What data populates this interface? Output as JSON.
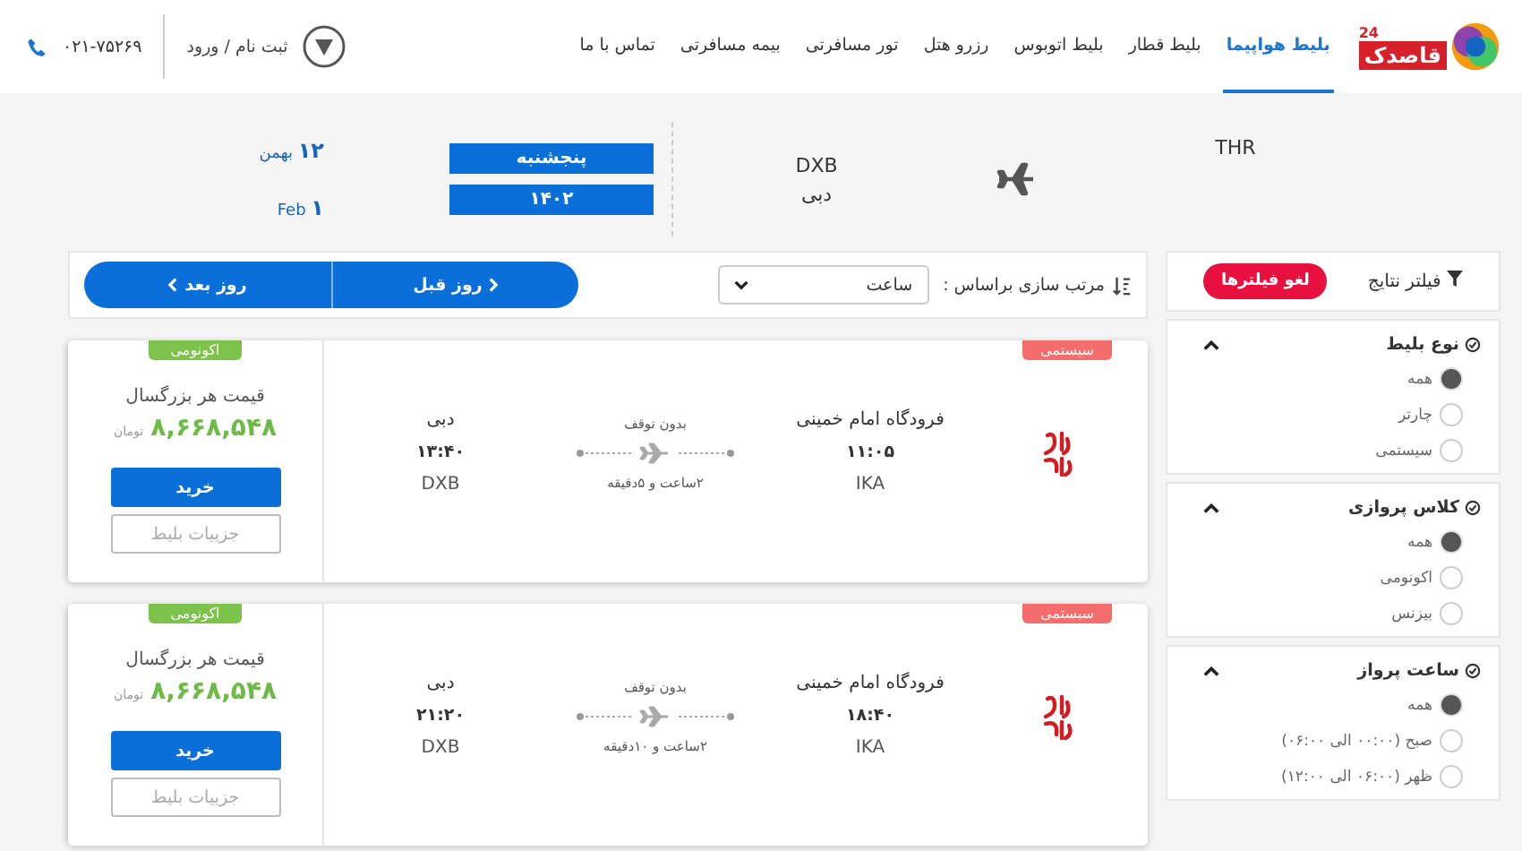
{
  "header": {
    "logo": {
      "text": "قاصدک",
      "badge": "24"
    },
    "nav": [
      {
        "label": "بلیط هواپیما",
        "selected": true
      },
      {
        "label": "بلیط قطار",
        "selected": false
      },
      {
        "label": "بلیط اتوبوس",
        "selected": false
      },
      {
        "label": "رزرو هتل",
        "selected": false
      },
      {
        "label": "تور مسافرتی",
        "selected": false
      },
      {
        "label": "بیمه مسافرتی",
        "selected": false
      },
      {
        "label": "تماس با ما",
        "selected": false
      }
    ],
    "login": "ثبت نام / ورود",
    "phone": "۰۲۱-۷۵۲۶۹"
  },
  "route": {
    "origin": "THR",
    "destination": {
      "code": "DXB",
      "city": "دبی"
    },
    "date": {
      "weekday": "پنجشنبه",
      "year": "۱۴۰۲",
      "persian": {
        "day": "۱۲",
        "month": "بهمن"
      },
      "gregorian": {
        "day": "۱",
        "month": "Feb"
      }
    }
  },
  "toolbar": {
    "sort_label": "مرتب سازی براساس :",
    "sort_value": "ساعت",
    "prev_day": "روز قبل",
    "next_day": "روز بعد"
  },
  "filters": {
    "title": "فیلتر نتایج",
    "clear": "لغو فیلترها",
    "groups": [
      {
        "title": "نوع بلیط",
        "expanded": true,
        "options": [
          {
            "label": "همه",
            "selected": true
          },
          {
            "label": "چارتر",
            "selected": false
          },
          {
            "label": "سیستمی",
            "selected": false
          }
        ]
      },
      {
        "title": "کلاس پروازی",
        "expanded": true,
        "options": [
          {
            "label": "همه",
            "selected": true
          },
          {
            "label": "اکونومی",
            "selected": false
          },
          {
            "label": "بیزنس",
            "selected": false
          }
        ]
      },
      {
        "title": "ساعت پرواز",
        "expanded": true,
        "options": [
          {
            "label": "همه",
            "selected": true
          },
          {
            "label": "صبح (۰۰:۰۰ الی ۰۶:۰۰)",
            "selected": false
          },
          {
            "label": "ظهر (۰۶:۰۰ الی ۱۲:۰۰)",
            "selected": false
          }
        ]
      }
    ]
  },
  "flights": [
    {
      "ticket_type": "سیستمی",
      "cabin": "اکونومی",
      "from": {
        "name": "فرودگاه امام خمینی",
        "time": "۱۱:۰۵",
        "code": "IKA"
      },
      "to": {
        "name": "دبی",
        "time": "۱۳:۴۰",
        "code": "DXB"
      },
      "stops": "بدون توقف",
      "duration": "۲ساعت و ۵دقیقه",
      "price_label": "قیمت هر بزرگسال",
      "price": "۸,۶۶۸,۵۴۸",
      "currency": "تومان",
      "buy": "خرید",
      "details": "جزییات بلیط"
    },
    {
      "ticket_type": "سیستمی",
      "cabin": "اکونومی",
      "from": {
        "name": "فرودگاه امام خمینی",
        "time": "۱۸:۴۰",
        "code": "IKA"
      },
      "to": {
        "name": "دبی",
        "time": "۲۱:۲۰",
        "code": "DXB"
      },
      "stops": "بدون توقف",
      "duration": "۲ساعت و ۱۰دقیقه",
      "price_label": "قیمت هر بزرگسال",
      "price": "۸,۶۶۸,۵۴۸",
      "currency": "تومان",
      "buy": "خرید",
      "details": "جزییات بلیط"
    }
  ]
}
